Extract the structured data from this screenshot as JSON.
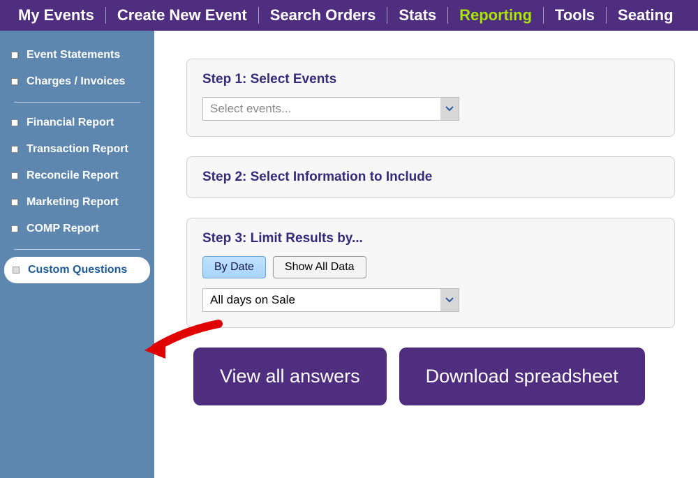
{
  "topnav": {
    "items": [
      {
        "label": "My Events"
      },
      {
        "label": "Create New Event"
      },
      {
        "label": "Search Orders"
      },
      {
        "label": "Stats"
      },
      {
        "label": "Reporting",
        "active": true
      },
      {
        "label": "Tools"
      },
      {
        "label": "Seating"
      }
    ]
  },
  "sidebar": {
    "items": [
      {
        "label": "Event Statements"
      },
      {
        "label": "Charges / Invoices"
      },
      {
        "label": "Financial Report"
      },
      {
        "label": "Transaction Report"
      },
      {
        "label": "Reconcile Report"
      },
      {
        "label": "Marketing Report"
      },
      {
        "label": "COMP Report"
      },
      {
        "label": "Custom Questions",
        "selected": true
      }
    ]
  },
  "step1": {
    "title": "Step 1: Select Events",
    "placeholder": "Select events..."
  },
  "step2": {
    "title": "Step 2: Select Information to Include"
  },
  "step3": {
    "title": "Step 3: Limit Results by...",
    "by_date": "By Date",
    "show_all": "Show All Data",
    "range_value": "All days on Sale"
  },
  "actions": {
    "view_all": "View all answers",
    "download": "Download spreadsheet"
  }
}
